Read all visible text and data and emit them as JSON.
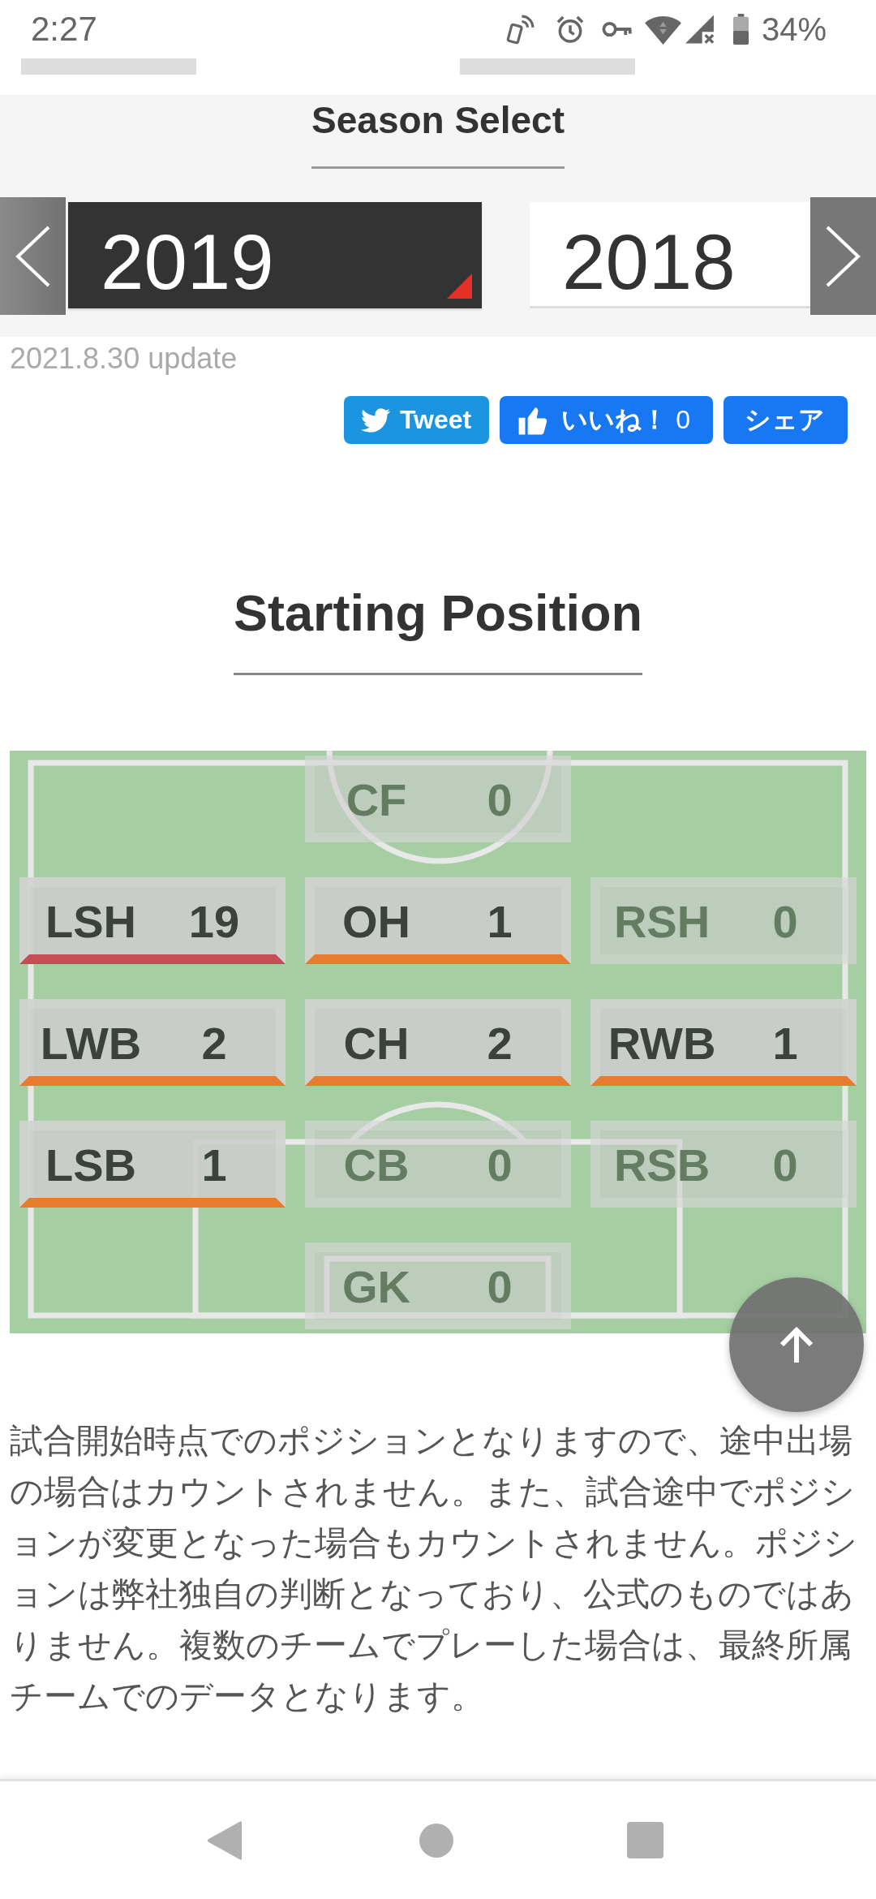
{
  "status_bar": {
    "time": "2:27",
    "battery": "34%"
  },
  "header": {
    "title": "Season Select",
    "seasons": [
      {
        "label": "2019",
        "selected": true
      },
      {
        "label": "2018",
        "selected": false
      }
    ]
  },
  "update_note": "2021.8.30 update",
  "share_buttons": [
    {
      "kind": "tweet",
      "label": "Tweet"
    },
    {
      "kind": "like",
      "label": "いいね！",
      "count": "0"
    },
    {
      "kind": "share",
      "label": "シェア"
    }
  ],
  "section": {
    "title": "Starting Position"
  },
  "pitch": {
    "rows": [
      {
        "positions": [
          {
            "code": "CF",
            "count": "0",
            "active": false
          }
        ]
      },
      {
        "positions": [
          {
            "code": "LSH",
            "count": "19",
            "active": true,
            "color": "#c64c55"
          },
          {
            "code": "OH",
            "count": "1",
            "active": true,
            "color": "#e87c2e"
          },
          {
            "code": "RSH",
            "count": "0",
            "active": false
          }
        ]
      },
      {
        "positions": [
          {
            "code": "LWB",
            "count": "2",
            "active": true,
            "color": "#e87c2e"
          },
          {
            "code": "CH",
            "count": "2",
            "active": true,
            "color": "#e87c2e"
          },
          {
            "code": "RWB",
            "count": "1",
            "active": true,
            "color": "#e87c2e"
          }
        ]
      },
      {
        "positions": [
          {
            "code": "LSB",
            "count": "1",
            "active": true,
            "color": "#e87c2e"
          },
          {
            "code": "CB",
            "count": "0",
            "active": false
          },
          {
            "code": "RSB",
            "count": "0",
            "active": false
          }
        ]
      },
      {
        "positions": [
          {
            "code": "GK",
            "count": "0",
            "active": false
          }
        ]
      }
    ]
  },
  "note": "試合開始時点でのポジションとなりますので、途中出場の場合はカウントされません。また、試合途中でポジションが変更となった場合もカウントされません。ポジションは弊社独自の判断となっており、公式のものではありません。複数のチームでプレーした場合は、最終所属チームでのデータとなります。"
}
